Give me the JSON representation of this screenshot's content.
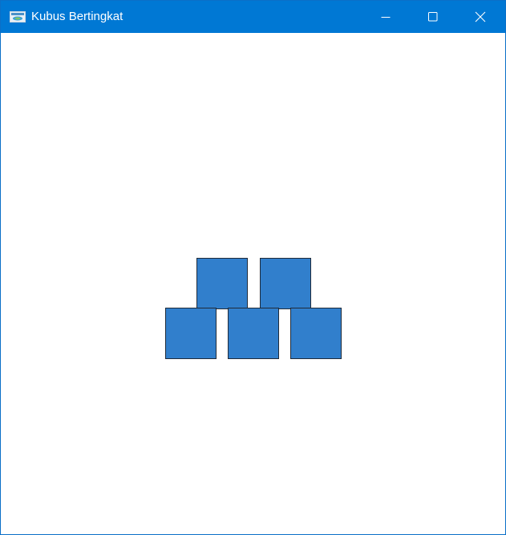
{
  "window": {
    "title": "Kubus Bertingkat",
    "titlebar_color": "#0078d4",
    "icons": {
      "app": "app-icon",
      "minimize": "minimize-icon",
      "maximize": "maximize-icon",
      "close": "close-icon"
    }
  },
  "canvas": {
    "cube_color": "#317fcc",
    "cube_border_color": "#1f2b3a",
    "rows": [
      {
        "row": "top",
        "count": 2
      },
      {
        "row": "bottom",
        "count": 3
      }
    ]
  }
}
